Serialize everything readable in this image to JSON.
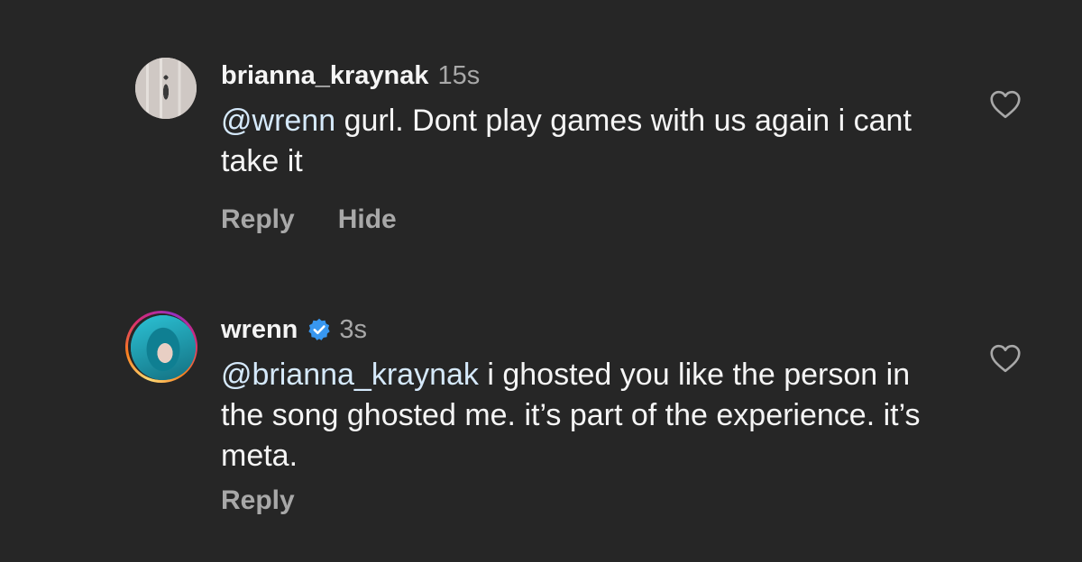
{
  "comments": [
    {
      "username": "brianna_kraynak",
      "time": "15s",
      "mention": "@wrenn",
      "text": " gurl. Dont play games with us again i cant take it",
      "actions": [
        "Reply",
        "Hide"
      ],
      "avatar_icon": "profile-photo",
      "like_icon": "heart-outline-icon"
    },
    {
      "username": "wrenn",
      "verified": true,
      "time": "3s",
      "mention": "@brianna_kraynak",
      "text": " i ghosted you like the person in the song ghosted me. it’s part of the experience. it’s meta.",
      "actions": [
        "Reply"
      ],
      "avatar_icon": "profile-photo-with-story-ring",
      "like_icon": "heart-outline-icon"
    }
  ],
  "colors": {
    "background": "#262626",
    "text": "#f5f5f5",
    "secondary": "#a8a8a8",
    "verified": "#3897f0"
  }
}
